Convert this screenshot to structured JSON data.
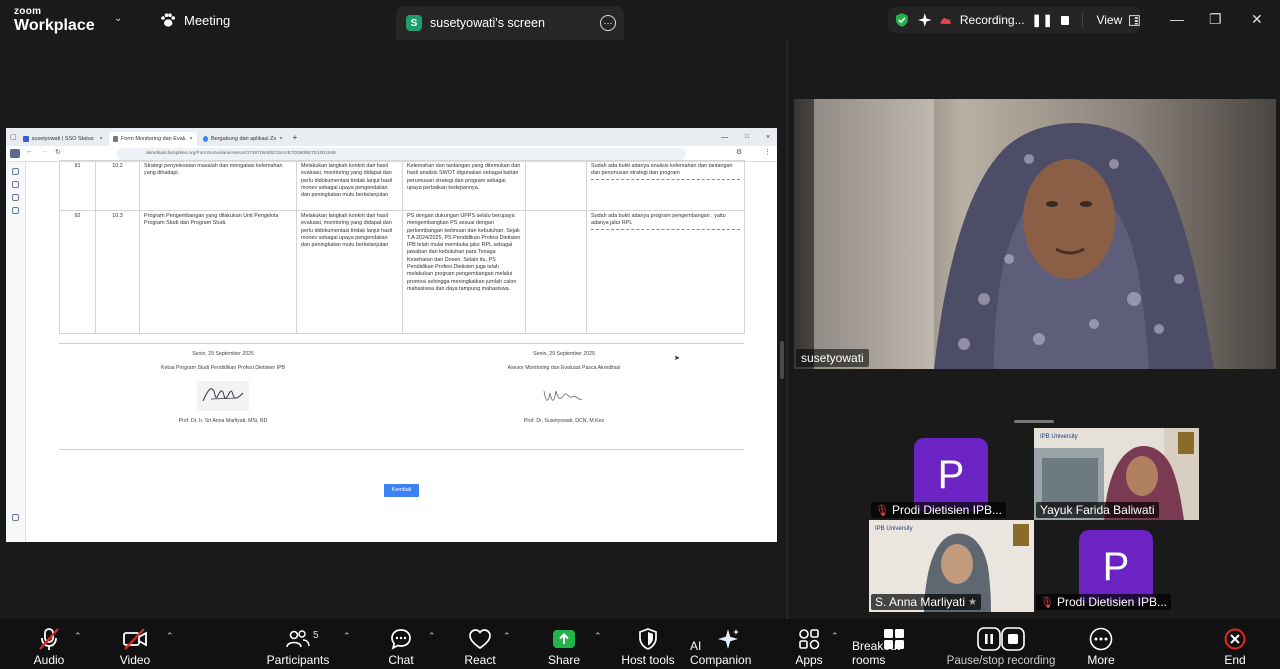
{
  "top": {
    "logo_line1": "zoom",
    "logo_line2": "Workplace",
    "meeting_label": "Meeting",
    "tab_badge": "S",
    "tab_title": "susetyowati's screen",
    "recording_label": "Recording...",
    "view_label": "View"
  },
  "browser": {
    "tabs": [
      "susetyowati | SSO Status",
      "Form Monitoring dan Evaluasi",
      "Bergabung dari aplikasi Zoom"
    ],
    "url": "akreditasi.lamptkes.org/FormSurveilansAsesor/37497084E5732A2E7D060BE7E1001846"
  },
  "doc": {
    "rows": [
      {
        "no": "91",
        "code": "10.2",
        "col3": "Strategi penyelesaian masalah dan mengatasi kelemahan yang dihadapi.",
        "col4": "Melakukan langkah konkrit dari hasil evaluasi, monitoring yang didapat dan perlu didokumentasi tindak lanjut hasil monev sebagai upaya pengendalian dan peningkatan mutu berkelanjutan",
        "col5": "Kelemahan dan tantangan yang ditemukan dari hasil analisis SWOT digunakan sebagai bahan perumusan strategi dan program sebagai upaya perbaikan kedepannya.",
        "col7": "Sudah ada bukti adanya analisis kelemahan dan tantangan dan perumusan strategi dan program"
      },
      {
        "no": "92",
        "code": "10.3",
        "col3": "Program Pengembangan yang dilakukan Unit Pengelola Program Studi dan Program Studi.",
        "col4": "Melakukan langkah konkrit dari hasil evaluasi, monitoring yang didapat dan perlu didokumentasi tindak lanjut hasil monev sebagai upaya pengendalian dan peningkatan mutu berkelanjutan",
        "col5": "PS dengan dukungan UPPS selalu berupaya mengembangkan PS sesuai dengan perkembangan keilmuan dan kebutuhan. Sejak T.A 2024/2025, PS Pendidikan Profesi Dietisien IPB telah mulai membuka jalur RPL sebagai jawaban dari kebutuhan para Tenaga Kesehatan dan Dosen. Selain itu, PS Pendidikan Profesi Dietisien juga telah melakukan program pengembangan melalui promosi sehingga meningkatkan jumlah calon mahasiswa dan daya tampung mahasiswa.",
        "col7": "Sudah ada bukti adanya program pengembangan , yaitu adanya jalur RPL"
      }
    ],
    "sig_left": {
      "date": "Senin, 29 September 2025",
      "role": "Ketua Program Studi Pendidikan Profesi Dietisien IPB",
      "name": "Prof. Dr. Ir. Sri Anna Marliyati, MSi, RD"
    },
    "sig_right": {
      "date": "Senin, 29 September 2025",
      "role": "Asesor Monitoring dan Evaluasi Pasca Akreditasi",
      "name": "Prof. Dr. Susetyowati, DCN, M.Kes"
    },
    "button": "Kembali"
  },
  "participants": {
    "speaker": "susetyowati",
    "tiles": [
      {
        "name": "Prodi Dietisien IPB...",
        "initial": "P"
      },
      {
        "name": "Yayuk Farida Baliwati"
      },
      {
        "name": "S. Anna Marliyati"
      },
      {
        "name": "Prodi Dietisien IPB...",
        "initial": "P"
      }
    ]
  },
  "toolbar": {
    "audio": "Audio",
    "video": "Video",
    "participants": "Participants",
    "participants_count": "5",
    "chat": "Chat",
    "react": "React",
    "share": "Share",
    "host_tools": "Host tools",
    "ai": "AI Companion",
    "apps": "Apps",
    "breakout": "Breakout rooms",
    "pause_rec": "Pause/stop recording",
    "more": "More",
    "end": "End"
  },
  "colors": {
    "accent": "#0e72ed",
    "share_green": "#23b34a",
    "end_red": "#e02828",
    "tile_purple": "#6c23c4"
  }
}
